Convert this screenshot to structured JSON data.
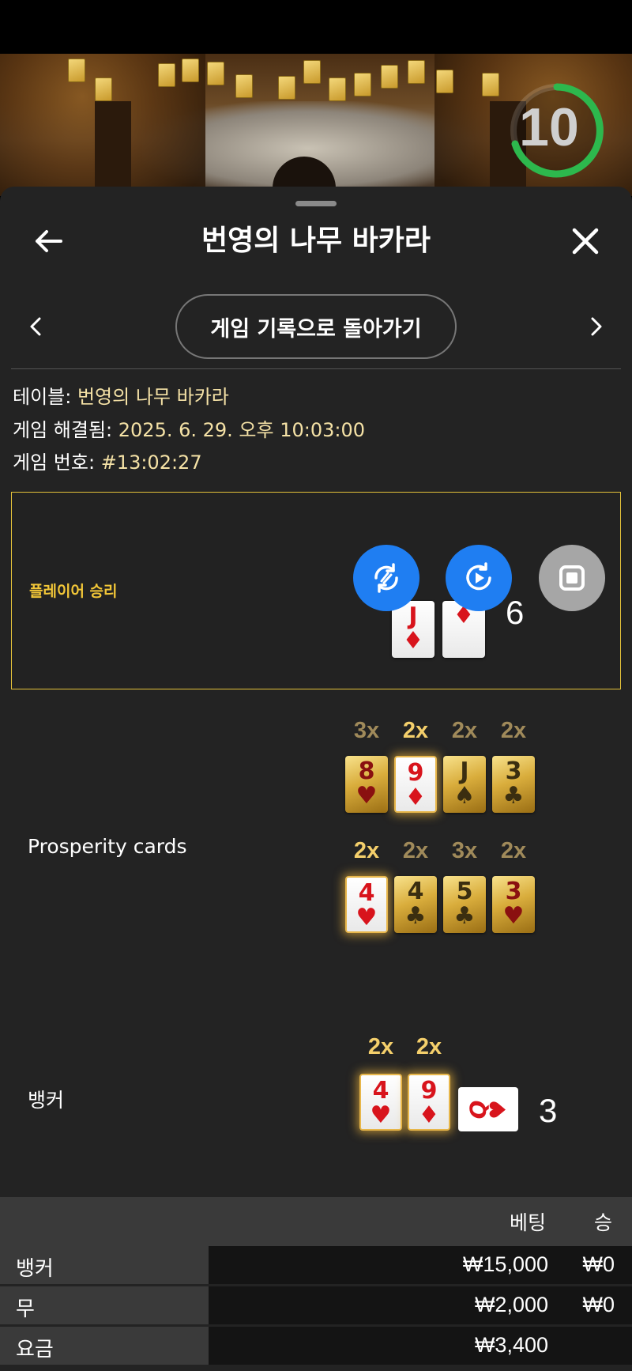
{
  "game": {
    "title": "번영의 나무 바카라",
    "countdown": "10",
    "history_button": "게임 기록으로 돌아가기"
  },
  "info": {
    "table_label": "테이블:",
    "table_value": "번영의 나무 바카라",
    "resolved_label": "게임 해결됨:",
    "resolved_value": "2025. 6. 29. 오후 10:03:00",
    "number_label": "게임 번호:",
    "number_value": "#13:02:27"
  },
  "player": {
    "label": "플레이어 승리",
    "cards": [
      {
        "rank": "J",
        "suit": "♦"
      },
      {
        "rank": "",
        "suit": "♦"
      }
    ],
    "score": "6"
  },
  "prosperity": {
    "label": "Prosperity cards",
    "row1": [
      {
        "mult": "3x",
        "rank": "8",
        "suit": "♥",
        "color": "red",
        "highlight": false
      },
      {
        "mult": "2x",
        "rank": "9",
        "suit": "♦",
        "color": "red",
        "highlight": true
      },
      {
        "mult": "2x",
        "rank": "J",
        "suit": "♠",
        "color": "black",
        "highlight": false
      },
      {
        "mult": "2x",
        "rank": "3",
        "suit": "♣",
        "color": "black",
        "highlight": false
      }
    ],
    "row2": [
      {
        "mult": "2x",
        "rank": "4",
        "suit": "♥",
        "color": "red",
        "highlight": true
      },
      {
        "mult": "2x",
        "rank": "4",
        "suit": "♣",
        "color": "black",
        "highlight": false
      },
      {
        "mult": "3x",
        "rank": "5",
        "suit": "♣",
        "color": "black",
        "highlight": false
      },
      {
        "mult": "2x",
        "rank": "3",
        "suit": "♥",
        "color": "red",
        "highlight": false
      }
    ]
  },
  "banker": {
    "label": "뱅커",
    "cards": [
      {
        "mult": "2x",
        "rank": "4",
        "suit": "♥"
      },
      {
        "mult": "2x",
        "rank": "9",
        "suit": "♦"
      }
    ],
    "extra_card": {
      "rank": "Q",
      "suit": "♥"
    },
    "score": "3"
  },
  "bets": {
    "header_bet": "베팅",
    "header_win": "승",
    "rows": [
      {
        "label": "뱅커",
        "bet": "₩15,000",
        "win": "₩0"
      },
      {
        "label": "무",
        "bet": "₩2,000",
        "win": "₩0"
      },
      {
        "label": "요금",
        "bet": "₩3,400",
        "win": ""
      }
    ]
  },
  "colors": {
    "accent_gold": "#e3c13a",
    "value_text": "#f5e2a6",
    "fab_blue": "#1f7ef2",
    "timer_green": "#2db84d"
  }
}
